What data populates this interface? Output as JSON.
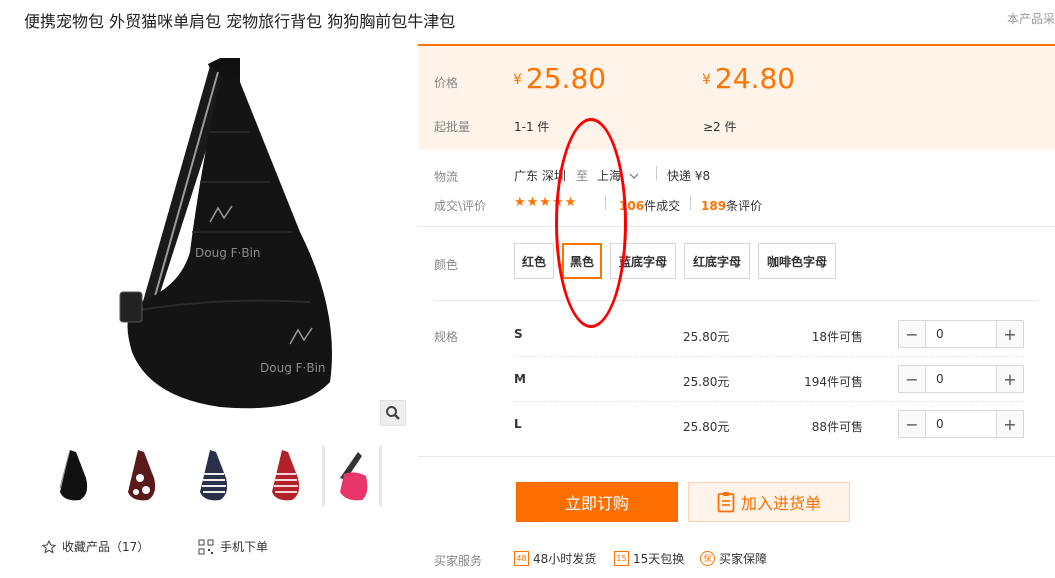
{
  "product": {
    "title": "便携宠物包 外贸猫咪单肩包 宠物旅行背包 狗狗胸前包牛津包",
    "top_right_note": "本产品采"
  },
  "pricing": {
    "price_label": "价格",
    "currency": "¥",
    "tiers": [
      {
        "price": "25.80",
        "moq": "1-1 件"
      },
      {
        "price": "24.80",
        "moq": "≥2 件"
      }
    ],
    "moq_label": "起批量"
  },
  "logistics": {
    "label": "物流",
    "from": "广东 深圳",
    "to_word": "至",
    "to": "上海",
    "shipping": "快递 ¥8"
  },
  "reviews": {
    "label": "成交\\评价",
    "stars": "★★★★★",
    "deals_count": "106",
    "deals_suffix": "件成交",
    "reviews_count": "189",
    "reviews_suffix": "条评价"
  },
  "colors": {
    "label": "颜色",
    "options": [
      "红色",
      "黑色",
      "蓝底字母",
      "红底字母",
      "咖啡色字母"
    ],
    "selected": "黑色"
  },
  "specs": {
    "label": "规格",
    "rows": [
      {
        "size": "S",
        "price": "25.80元",
        "stock": "18件可售",
        "qty": "0"
      },
      {
        "size": "M",
        "price": "25.80元",
        "stock": "194件可售",
        "qty": "0"
      },
      {
        "size": "L",
        "price": "25.80元",
        "stock": "88件可售",
        "qty": "0"
      }
    ]
  },
  "actions": {
    "buy_now": "立即订购",
    "add_to_cart": "加入进货单"
  },
  "services": {
    "label": "买家服务",
    "items": [
      {
        "icon": "48h-icon",
        "text": "48小时发货"
      },
      {
        "icon": "15day-icon",
        "text": "15天包换"
      },
      {
        "icon": "guarantee-icon",
        "text": "买家保障"
      }
    ]
  },
  "gallery": {
    "favorite_label": "收藏产品（17）",
    "mobile_order_label": "手机下单",
    "thumbnails": [
      "black",
      "brown-pattern",
      "blue-letters",
      "red-letters",
      "pink"
    ]
  },
  "colors_theme": {
    "accent": "#ff7300",
    "price_panel_bg": "#fff3ea",
    "annotation": "#ff0000"
  }
}
